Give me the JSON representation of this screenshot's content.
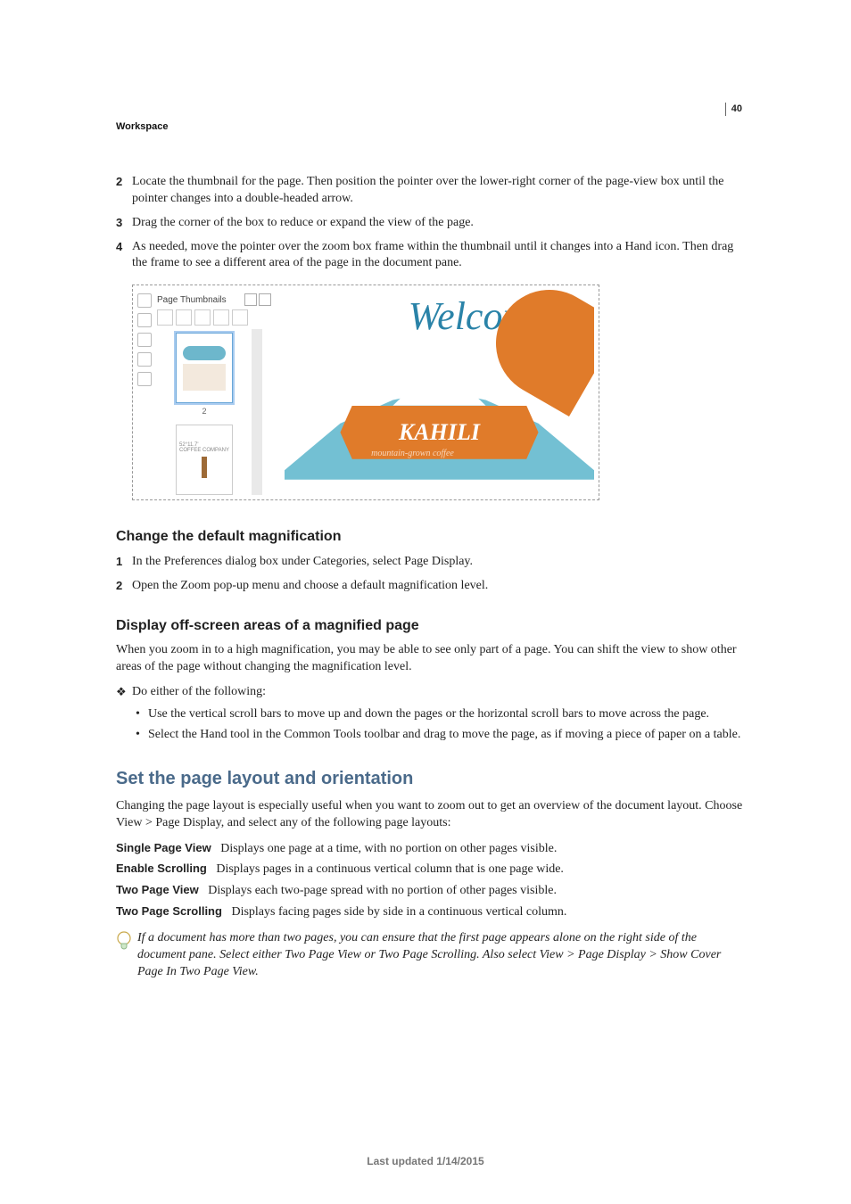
{
  "page": {
    "section_tag": "Workspace",
    "page_number": "40",
    "footer": "Last updated 1/14/2015"
  },
  "steps_top": [
    {
      "n": "2",
      "text": "Locate the thumbnail for the page. Then position the pointer over the lower-right corner of the page-view box until the pointer changes into a double-headed arrow."
    },
    {
      "n": "3",
      "text": "Drag the corner of the box to reduce or expand the view of the page."
    },
    {
      "n": "4",
      "text": "As needed, move the pointer over the zoom box frame within the thumbnail until it changes into a Hand icon. Then drag the frame to see a different area of the page in the document pane."
    }
  ],
  "figure": {
    "thumbs_title": "Page Thumbnails",
    "thumb_labels": [
      "2"
    ],
    "welcome": "Welcome to",
    "banner_main": "KAHILI",
    "banner_sub": "mountain-grown coffee"
  },
  "section_a": {
    "heading": "Change the default magnification",
    "steps": [
      {
        "n": "1",
        "text": "In the Preferences dialog box under Categories, select Page Display."
      },
      {
        "n": "2",
        "text": "Open the Zoom pop-up menu and choose a default magnification level."
      }
    ]
  },
  "section_b": {
    "heading": "Display off-screen areas of a magnified page",
    "intro": "When you zoom in to a high magnification, you may be able to see only part of a page. You can shift the view to show other areas of the page without changing the magnification level.",
    "bullet_lead": "Do either of the following:",
    "subs": [
      "Use the vertical scroll bars to move up and down the pages or the horizontal scroll bars to move across the page.",
      "Select the Hand tool in the Common Tools toolbar and drag to move the page, as if moving a piece of paper on a table."
    ]
  },
  "section_c": {
    "heading": "Set the page layout and orientation",
    "intro": "Changing the page layout is especially useful when you want to zoom out to get an overview of the document layout. Choose View > Page Display, and select any of the following page layouts:",
    "defs": [
      {
        "term": "Single Page View",
        "desc": "Displays one page at a time, with no portion on other pages visible."
      },
      {
        "term": "Enable Scrolling",
        "desc": "Displays pages in a continuous vertical column that is one page wide."
      },
      {
        "term": "Two Page View",
        "desc": "Displays each two-page spread with no portion of other pages visible."
      },
      {
        "term": "Two Page Scrolling",
        "desc": "Displays facing pages side by side in a continuous vertical column."
      }
    ],
    "tip": "If a document has more than two pages, you can ensure that the first page appears alone on the right side of the document pane. Select either Two Page View or Two Page Scrolling. Also select View > Page Display > Show Cover Page In Two Page View."
  }
}
